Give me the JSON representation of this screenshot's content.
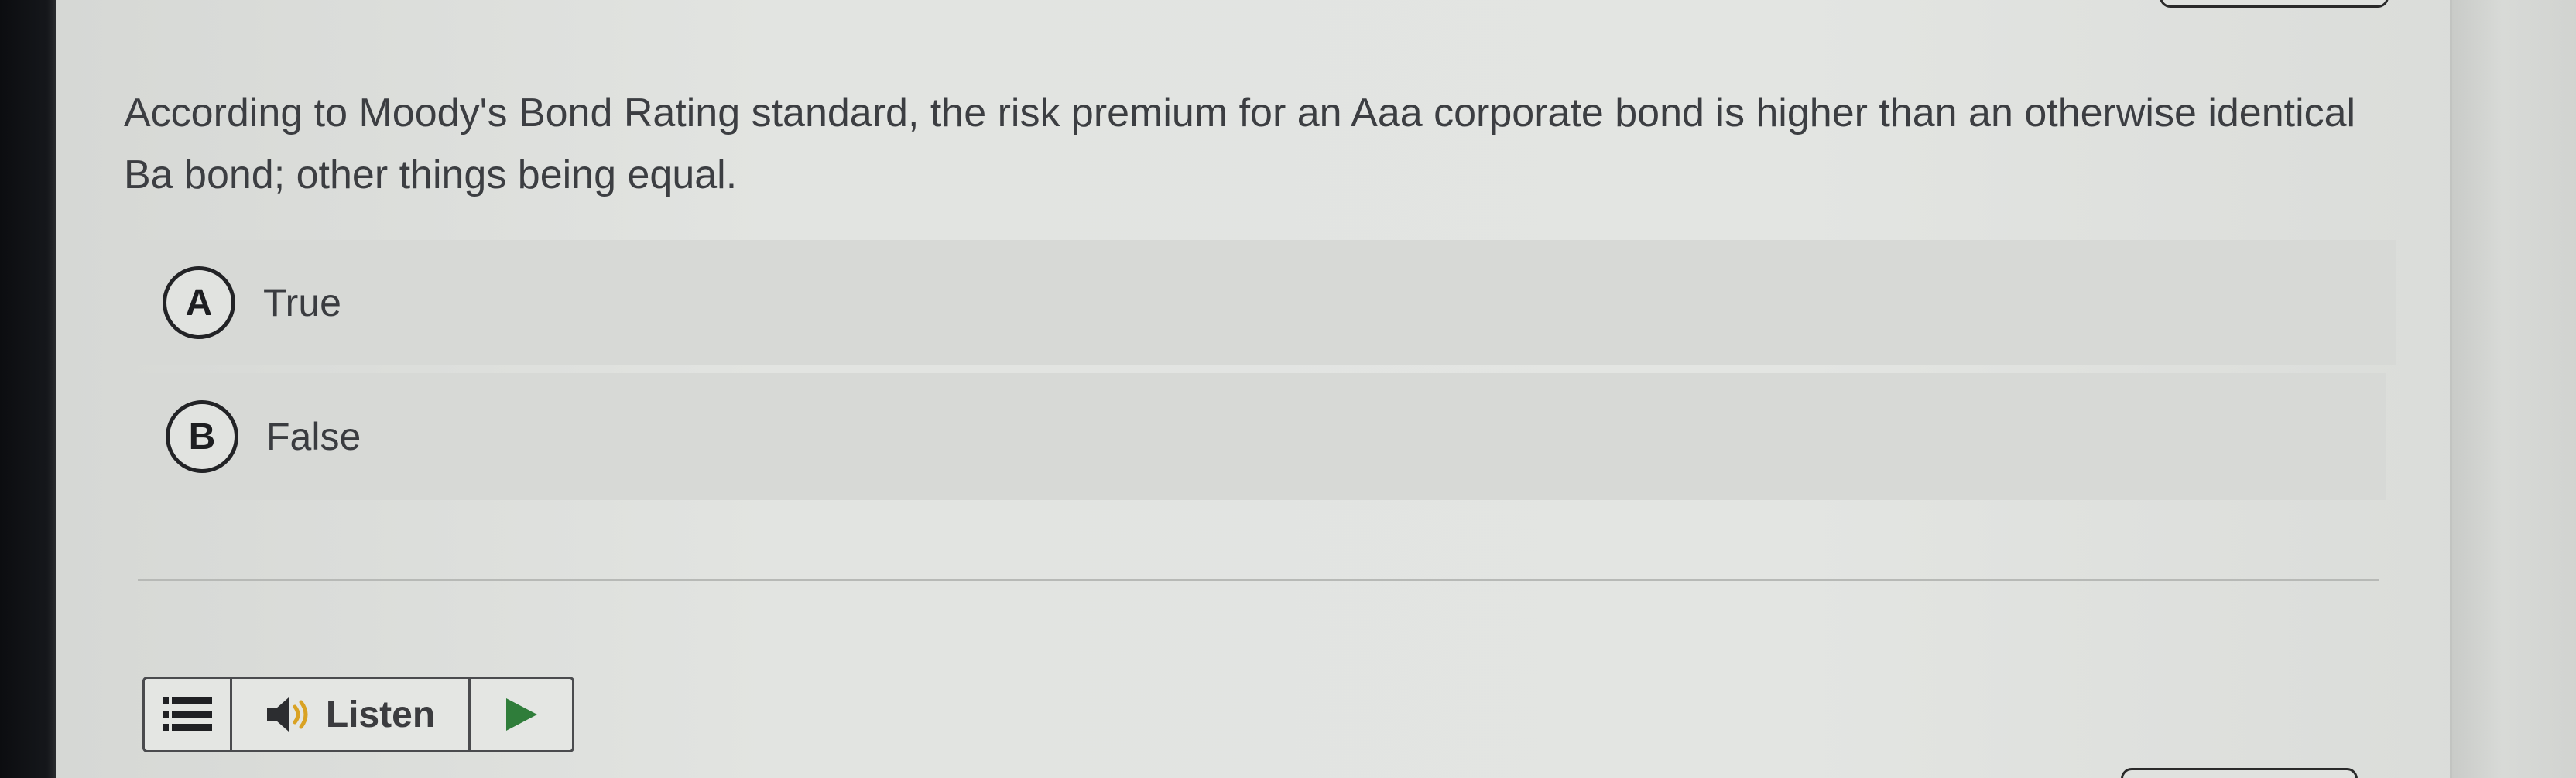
{
  "question": {
    "text": "According to Moody's Bond Rating standard, the risk premium for an Aaa corporate bond is higher than an otherwise identical Ba bond; other things being equal."
  },
  "choices": [
    {
      "letter": "A",
      "label": "True"
    },
    {
      "letter": "B",
      "label": "False"
    }
  ],
  "toolbar": {
    "menu_icon": "hamburger-menu-icon",
    "speaker_icon": "speaker-icon",
    "listen_label": "Listen",
    "play_icon": "play-icon",
    "play_color": "#2f7d3a"
  }
}
